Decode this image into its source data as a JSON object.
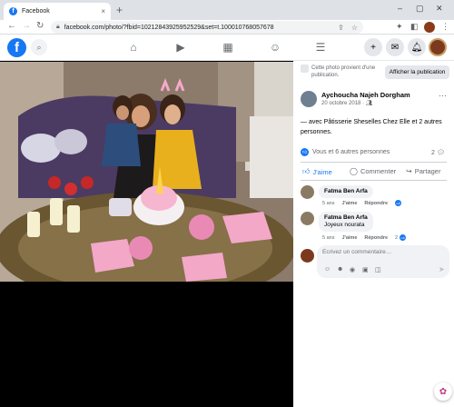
{
  "browser": {
    "tab_title": "Facebook",
    "tab_close": "×",
    "new_tab": "+",
    "url": "facebook.com/photo/?fbid=10212843925952529&set=t.100010768057678",
    "window_controls": [
      "–",
      "▢",
      "✕"
    ]
  },
  "fb_header": {
    "logo": "f",
    "nav_icons": [
      "home-icon",
      "watch-icon",
      "marketplace-icon",
      "groups-icon",
      "menu-icon"
    ]
  },
  "panel": {
    "notice": "Cette photo provient d'une publication.",
    "view_post_button": "Afficher la publication",
    "author": "Aychoucha Najeh Dorgham",
    "date": "20 octobre 2018 ·",
    "text": "— avec Pâtisserie Sheselles Chez Elle et 2 autres personnes.",
    "reactions_text": "Vous et 6 autres personnes",
    "comments_count": "2",
    "actions": {
      "like": "J'aime",
      "comment": "Commenter",
      "share": "Partager"
    },
    "comments": [
      {
        "author": "Fatma Ben Arfa",
        "text": "",
        "time": "5 ans",
        "like": "J'aime",
        "reply": "Répondre",
        "reactions": ""
      },
      {
        "author": "Fatma Ben Arfa",
        "text": "Joyeux nourata",
        "time": "5 ans",
        "like": "J'aime",
        "reply": "Répondre",
        "reactions": "2"
      }
    ],
    "compose_placeholder": "Écrivez un commentaire…"
  },
  "colors": {
    "fb_blue": "#1877f2",
    "viewer_bg": "#000000",
    "panel_bg": "#ffffff"
  }
}
